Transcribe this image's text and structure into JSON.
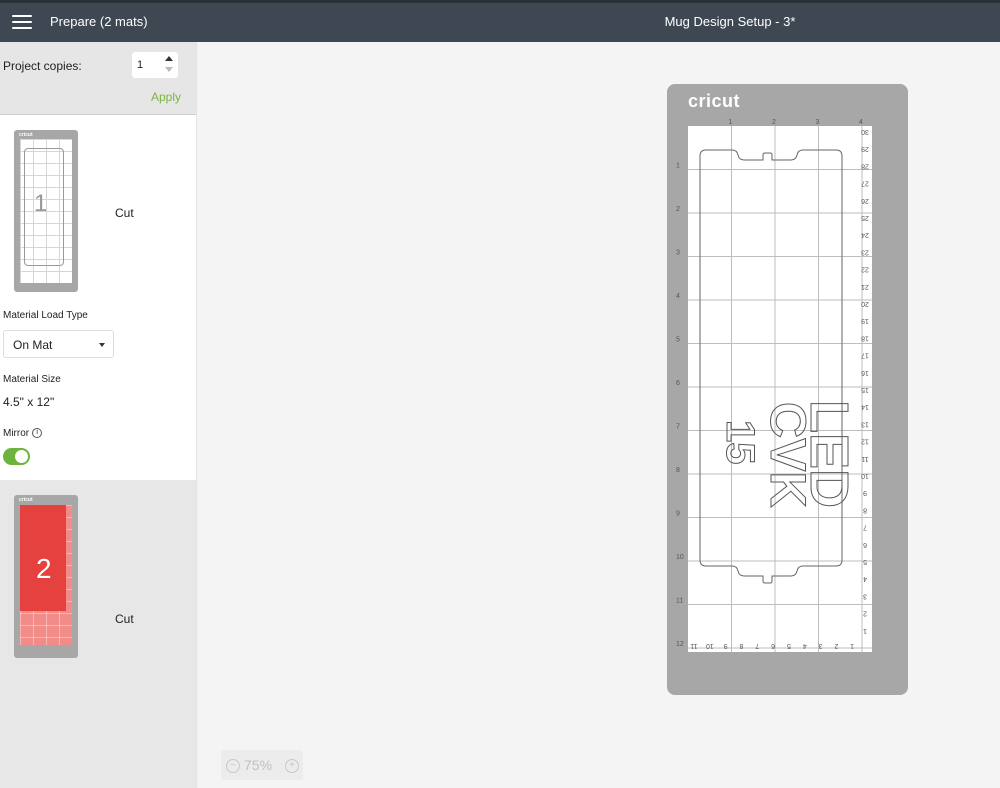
{
  "header": {
    "menu_icon": "hamburger-icon",
    "prepare_label": "Prepare (2 mats)",
    "project_title": "Mug Design Setup - 3*"
  },
  "sidebar": {
    "copies_label": "Project copies:",
    "copies_value": "1",
    "apply_label": "Apply",
    "apply_color": "#7cb342",
    "mats": [
      {
        "brand": "cricut",
        "number": "1",
        "action": "Cut"
      },
      {
        "brand": "cricut",
        "number": "2",
        "action": "Cut",
        "color": "#e5413e"
      }
    ],
    "material_load_type_label": "Material Load Type",
    "material_load_type_value": "On Mat",
    "material_size_label": "Material Size",
    "material_size_value": "4.5\" x 12\"",
    "mirror_label": "Mirror",
    "mirror_info_icon": "info-icon",
    "mirror_on": true,
    "toggle_color": "#6fb33f"
  },
  "zoom": {
    "value": "75%",
    "minus_icon": "zoom-out-icon",
    "plus_icon": "zoom-in-icon"
  },
  "mat": {
    "brand": "cricut",
    "top_ruler": [
      "1",
      "2",
      "3",
      "4"
    ],
    "left_ruler": [
      "1",
      "2",
      "3",
      "4",
      "5",
      "6",
      "7",
      "8",
      "9",
      "10",
      "11",
      "12"
    ],
    "right_ruler": [
      "30",
      "29",
      "28",
      "27",
      "26",
      "25",
      "24",
      "23",
      "22",
      "21",
      "20",
      "19",
      "18",
      "17",
      "16",
      "15",
      "14",
      "13",
      "12",
      "11",
      "10",
      "9",
      "8",
      "7",
      "6",
      "5",
      "4",
      "3",
      "2",
      "1"
    ],
    "bottom_ruler": [
      "11",
      "10",
      "9",
      "8",
      "7",
      "6",
      "5",
      "4",
      "3",
      "2",
      "1"
    ],
    "design_text": [
      "CVK",
      "15",
      "LED"
    ]
  }
}
